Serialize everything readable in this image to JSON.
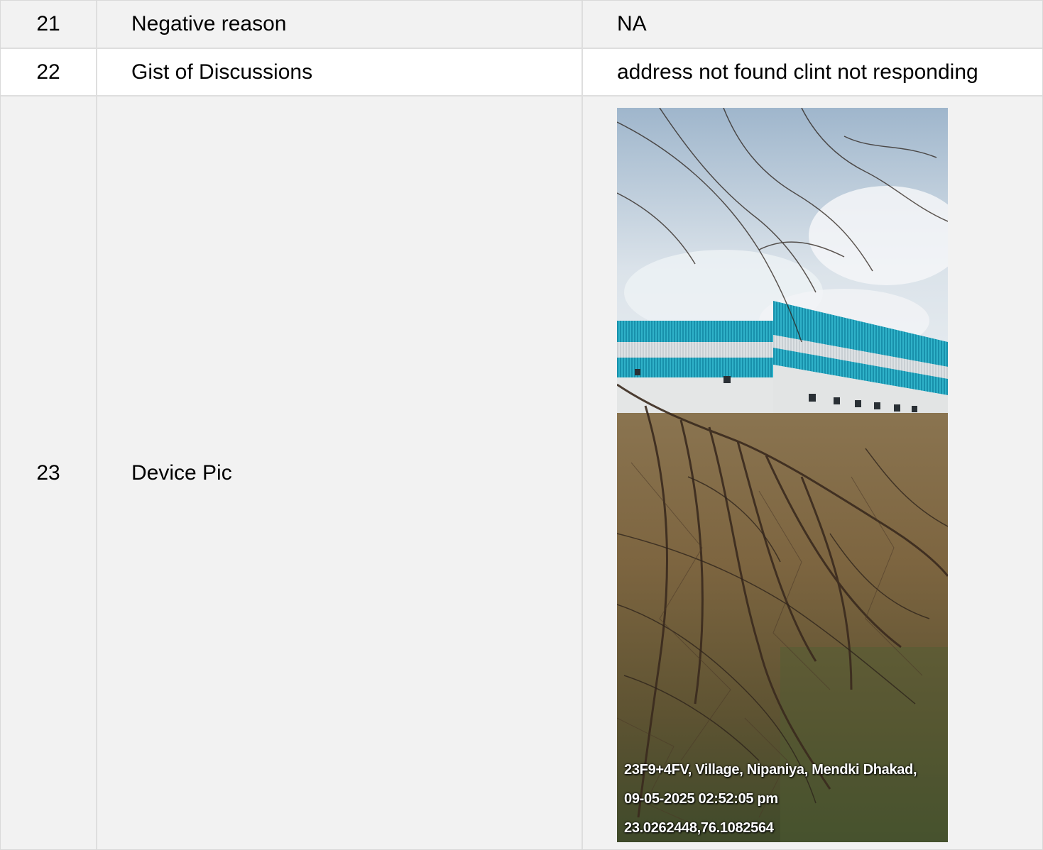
{
  "rows": [
    {
      "num": "21",
      "label": "Negative reason",
      "value": "NA"
    },
    {
      "num": "22",
      "label": "Gist of Discussions",
      "value": "address not found clint not responding"
    },
    {
      "num": "23",
      "label": "Device Pic"
    }
  ],
  "photo": {
    "overlay_address": "23F9+4FV, Village, Nipaniya, Mendki Dhakad,",
    "overlay_datetime": "09-05-2025 02:52:05 pm",
    "overlay_coords": "23.0262448,76.1082564"
  },
  "colors": {
    "row_alt": "#f2f2f2",
    "row_plain": "#ffffff",
    "border": "#dedede",
    "shed_teal": "#1f9fb8",
    "sky": "#cfd9e3"
  }
}
